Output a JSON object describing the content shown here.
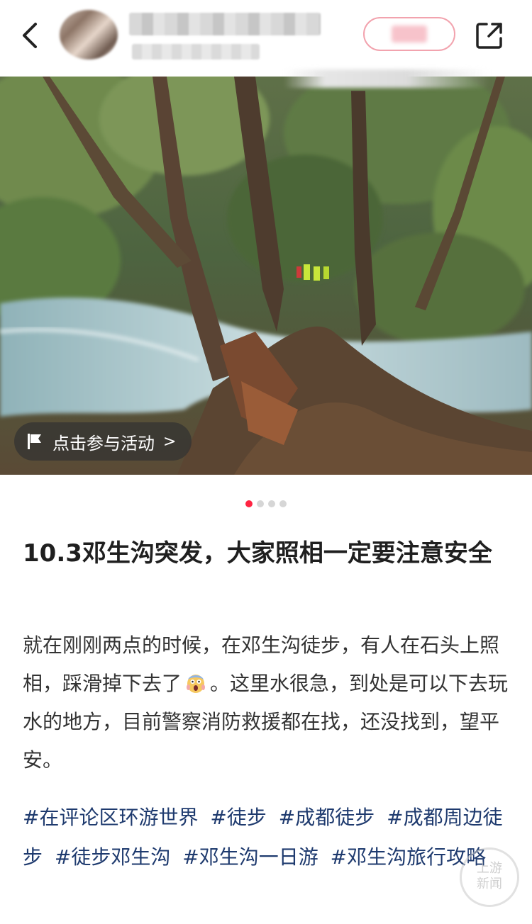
{
  "header": {
    "author_name": "",
    "author_meta": "",
    "follow_label": ""
  },
  "photo": {
    "activity_label": "点击参与活动",
    "activity_chevron": ">"
  },
  "carousel": {
    "total": 4,
    "active_index": 0
  },
  "post": {
    "title": "10.3邓生沟突发，大家照相一定要注意安全",
    "body_part1": "就在刚刚两点的时候，在邓生沟徒步，有人在石头上照相，踩滑掉下去了",
    "body_emoji": "scream-emoji",
    "body_part2": "。这里水很急，到处是可以下去玩水的地方，目前警察消防救援都在找，还没找到，望平安。",
    "tags": [
      "#在评论区环游世界",
      "#徒步",
      "#成都徒步",
      "#成都周边徒步",
      "#徒步邓生沟",
      "#邓生沟一日游",
      "#邓生沟旅行攻略"
    ]
  },
  "watermark": {
    "line1": "上游",
    "line2": "新闻"
  },
  "colors": {
    "accent": "#ff2442",
    "tag": "#1e3a6e",
    "pill_bg": "#323232"
  }
}
